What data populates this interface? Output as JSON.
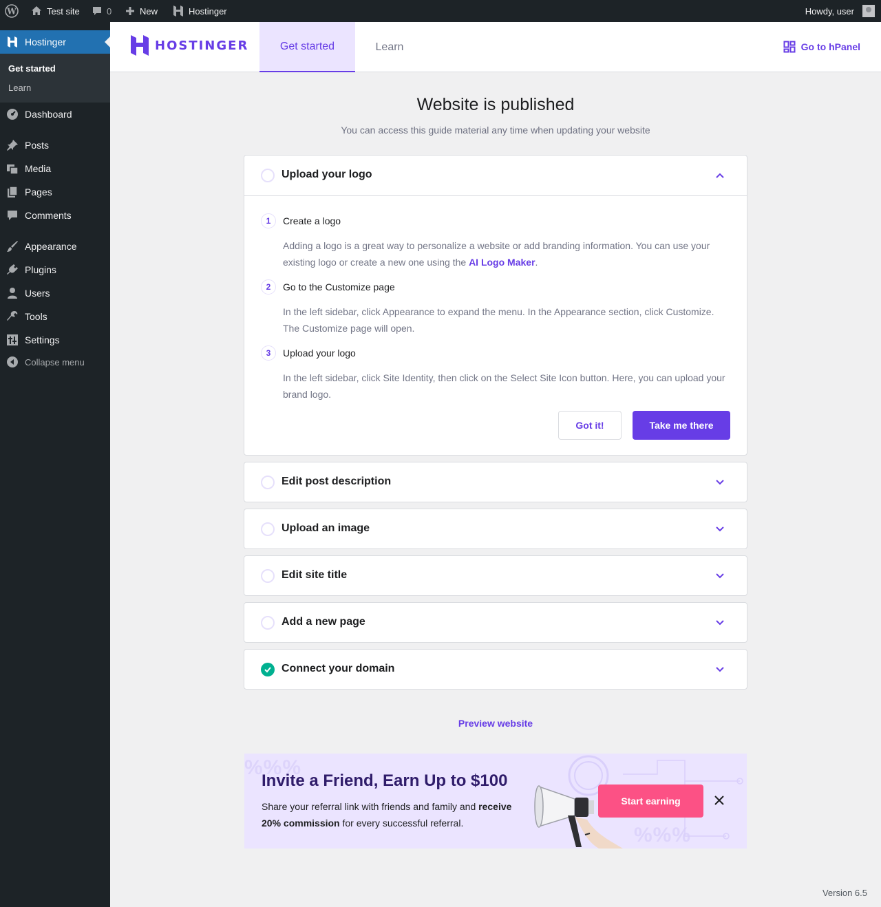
{
  "admin_bar": {
    "site_name": "Test site",
    "comments_count": "0",
    "new_label": "New",
    "hostinger_label": "Hostinger",
    "greeting": "Howdy, user"
  },
  "sidebar": {
    "current": "Hostinger",
    "submenu": [
      "Get started",
      "Learn"
    ],
    "items": [
      {
        "label": "Dashboard",
        "icon": "dashboard-icon"
      },
      {
        "label": "Posts",
        "icon": "pin-icon"
      },
      {
        "label": "Media",
        "icon": "media-icon"
      },
      {
        "label": "Pages",
        "icon": "pages-icon"
      },
      {
        "label": "Comments",
        "icon": "comment-icon"
      },
      {
        "label": "Appearance",
        "icon": "brush-icon"
      },
      {
        "label": "Plugins",
        "icon": "plug-icon"
      },
      {
        "label": "Users",
        "icon": "user-icon"
      },
      {
        "label": "Tools",
        "icon": "wrench-icon"
      },
      {
        "label": "Settings",
        "icon": "sliders-icon"
      }
    ],
    "collapse_label": "Collapse menu"
  },
  "header": {
    "logo_text": "HOSTINGER",
    "tabs": [
      "Get started",
      "Learn"
    ],
    "active_tab": "Get started",
    "hpanel_label": "Go to hPanel"
  },
  "main": {
    "title": "Website is published",
    "subtitle": "You can access this guide material any time when updating your website",
    "expanded_card": {
      "title": "Upload your logo",
      "steps": [
        {
          "num": "1",
          "title": "Create a logo",
          "desc_before": "Adding a logo is a great way to personalize a website or add branding information. You can use your existing logo or create a new one using the ",
          "link": "AI Logo Maker",
          "desc_after": "."
        },
        {
          "num": "2",
          "title": "Go to the Customize page",
          "desc": "In the left sidebar, click Appearance to expand the menu. In the Appearance section, click Customize. The Customize page will open."
        },
        {
          "num": "3",
          "title": "Upload your logo",
          "desc": "In the left sidebar, click Site Identity, then click on the Select Site Icon button. Here, you can upload your brand logo."
        }
      ],
      "secondary_button": "Got it!",
      "primary_button": "Take me there"
    },
    "collapsed_cards": [
      {
        "title": "Edit post description",
        "completed": false
      },
      {
        "title": "Upload an image",
        "completed": false
      },
      {
        "title": "Edit site title",
        "completed": false
      },
      {
        "title": "Add a new page",
        "completed": false
      },
      {
        "title": "Connect your domain",
        "completed": true
      }
    ],
    "preview_link": "Preview website"
  },
  "banner": {
    "title": "Invite a Friend, Earn Up to $100",
    "text_before": "Share your referral link with friends and family and ",
    "text_bold": "receive 20% commission",
    "text_after": " for every successful referral.",
    "button": "Start earning",
    "decor": "%%%"
  },
  "footer": {
    "version": "Version 6.5"
  },
  "colors": {
    "brand": "#673de6",
    "admin_bg": "#1d2327",
    "sidebar_active": "#2271b1",
    "success": "#00b090",
    "cta": "#fc5185"
  }
}
